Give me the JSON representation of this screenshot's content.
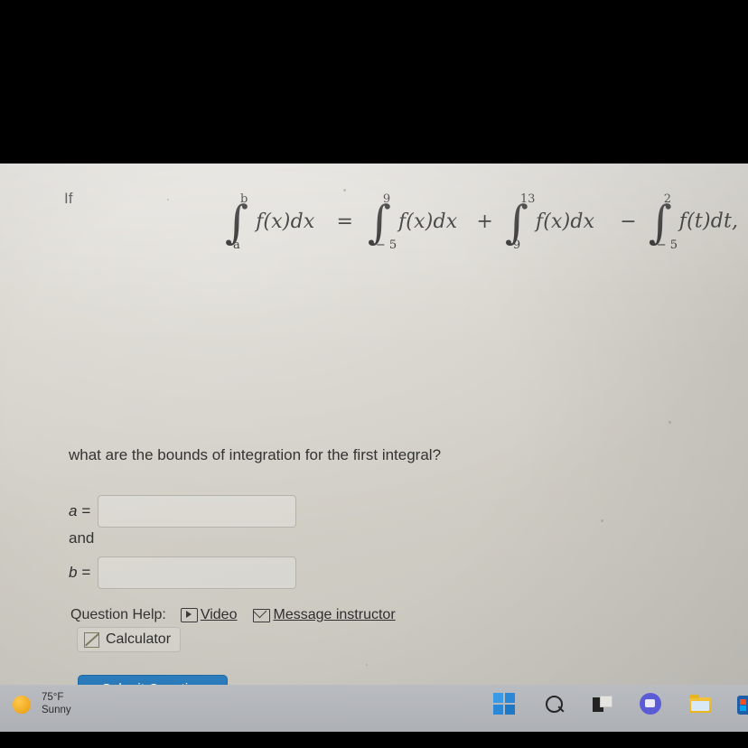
{
  "screen": {
    "background_color": "#d3d0c8"
  },
  "question": {
    "intro": "If",
    "prompt": "what are the bounds of integration for the first integral?",
    "equation": {
      "term1": {
        "lower": "a",
        "upper": "b",
        "integrand": "f(x)dx"
      },
      "relation": "=",
      "term2": {
        "lower": "− 5",
        "upper": "9",
        "integrand": "f(x)dx"
      },
      "op1": "+",
      "term3": {
        "lower": "9",
        "upper": "13",
        "integrand": "f(x)dx"
      },
      "op2": "−",
      "term4": {
        "lower": "− 5",
        "upper": "2",
        "integrand": "f(t)dt,"
      }
    }
  },
  "answers": {
    "a": {
      "label": "a =",
      "value": "",
      "placeholder": ""
    },
    "conjunction": "and",
    "b": {
      "label": "b =",
      "value": "",
      "placeholder": ""
    }
  },
  "help": {
    "label": "Question Help:",
    "video_link": "Video",
    "video_icon": "video-play-icon",
    "message_link": "Message instructor",
    "message_icon": "envelope-icon",
    "calculator_button": "Calculator",
    "calculator_icon": "calculator-icon"
  },
  "submit": {
    "label": "Submit Question",
    "color": "#2477b8"
  },
  "taskbar": {
    "weather": {
      "temperature": "75°F",
      "condition": "Sunny",
      "icon": "sun-icon"
    },
    "icons": [
      {
        "name": "start-icon",
        "title": "Start"
      },
      {
        "name": "search-icon",
        "title": "Search"
      },
      {
        "name": "task-view-icon",
        "title": "Task View"
      },
      {
        "name": "chat-icon",
        "title": "Chat"
      },
      {
        "name": "file-explorer-icon",
        "title": "File Explorer"
      },
      {
        "name": "microsoft-store-icon",
        "title": "Microsoft Store"
      }
    ]
  }
}
